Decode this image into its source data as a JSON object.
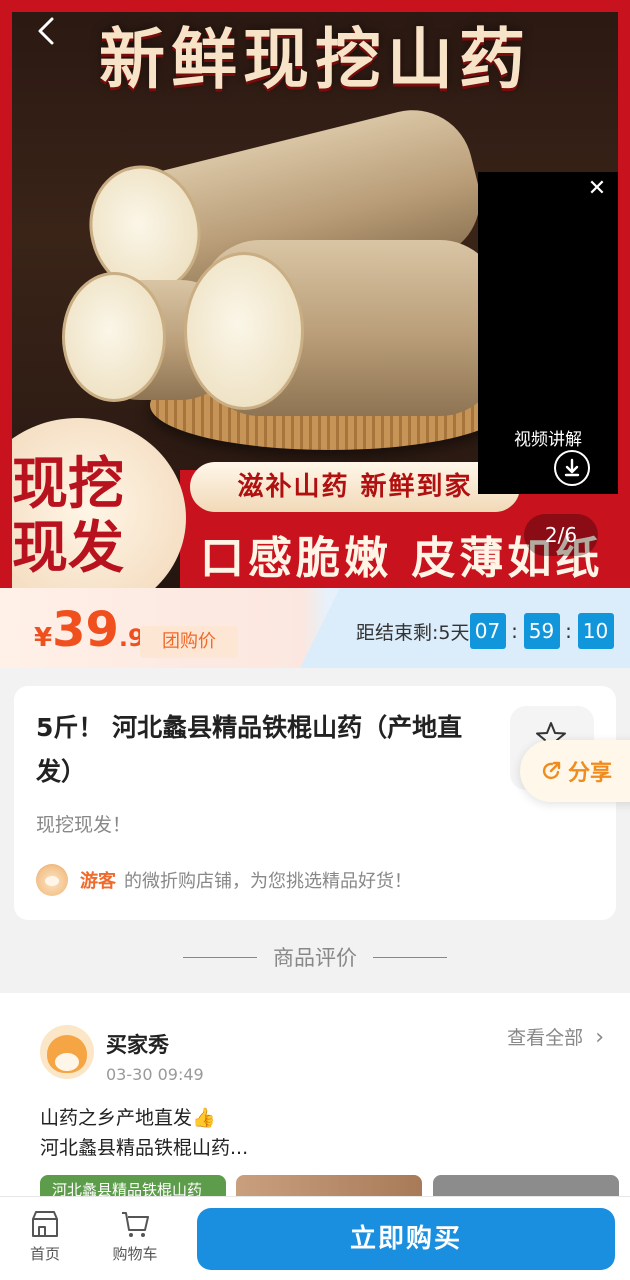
{
  "hero": {
    "title": "新鲜现挖山药",
    "slogan_small": "滋补山药 新鲜到家",
    "slogan_big": "口感脆嫩 皮薄如纸",
    "badge": "现挖现发",
    "video_label": "视频讲解",
    "image_counter": "2/6",
    "accent_color": "#c8121e"
  },
  "price": {
    "currency": "¥",
    "integer": "39",
    "decimal": ".9",
    "tag": "团购价",
    "countdown_label": "距结束剩:5天",
    "hours": "07",
    "minutes": "59",
    "seconds": "10",
    "sep": ":",
    "price_color": "#f0501e",
    "countdown_color": "#1296db"
  },
  "product": {
    "title": "5斤！ 河北蠡县精品铁棍山药（产地直发）",
    "subtitle": "现挖现发！",
    "shop_user": "游客",
    "shop_text": "的微折购店铺，为您挑选精品好货！",
    "share_label": "分享"
  },
  "reviews": {
    "section_title": "商品评价",
    "name": "买家秀",
    "date": "03-30 09:49",
    "view_all": "查看全部",
    "chevron": "›",
    "line1": "山药之乡产地直发👍",
    "line2": "河北蠡县精品铁棍山药...",
    "thumb1_text": "河北蠡县精品铁棍山药"
  },
  "bottom": {
    "home_label": "首页",
    "cart_label": "购物车",
    "buy_label": "立即购买",
    "buy_color": "#1a8fe0"
  },
  "icons": [
    "back-arrow-icon",
    "close-icon",
    "download-icon",
    "star-icon",
    "share-icon",
    "store-icon",
    "cart-icon",
    "chevron-right-icon"
  ]
}
